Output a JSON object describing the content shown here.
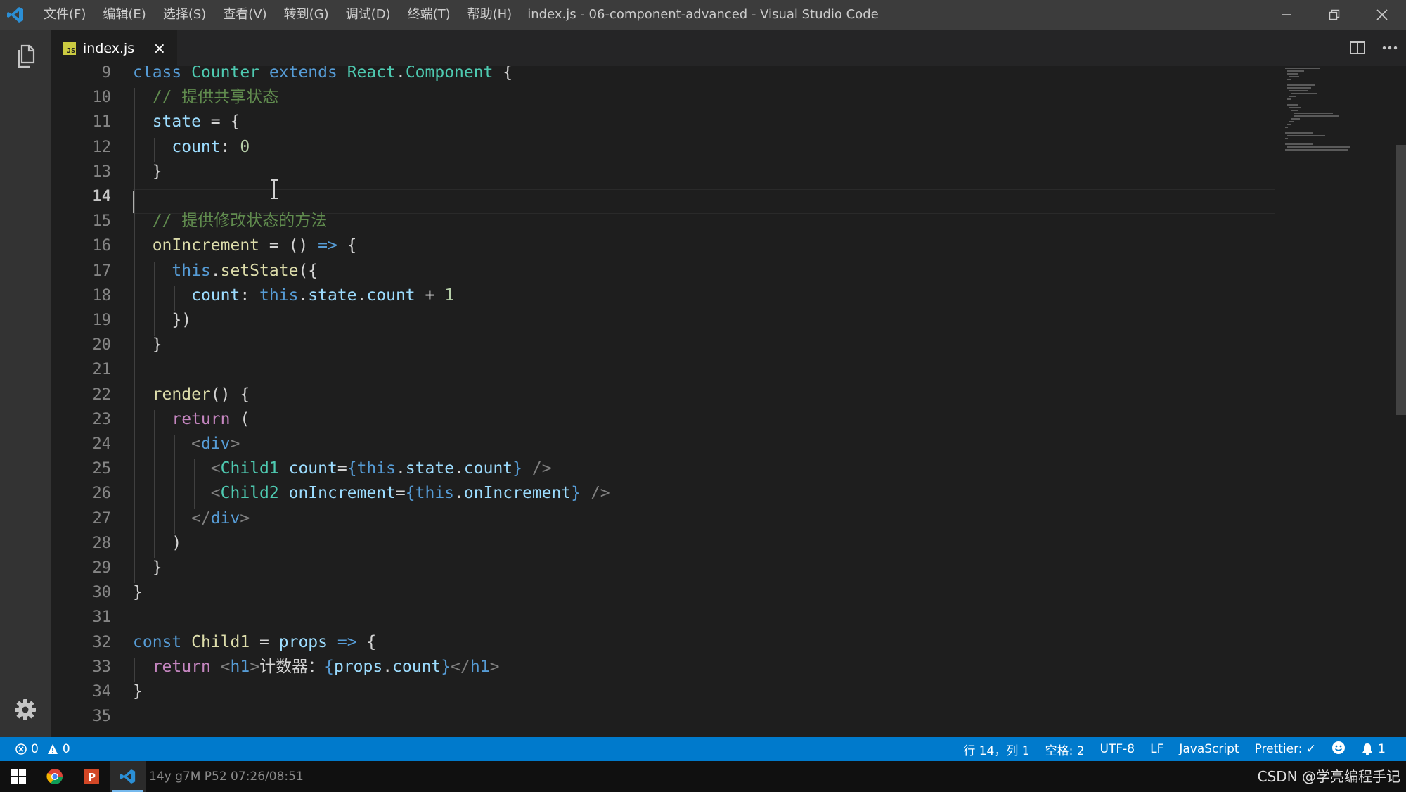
{
  "window": {
    "title": "index.js - 06-component-advanced - Visual Studio Code",
    "menu": [
      "文件(F)",
      "编辑(E)",
      "选择(S)",
      "查看(V)",
      "转到(G)",
      "调试(D)",
      "终端(T)",
      "帮助(H)"
    ]
  },
  "tab": {
    "label": "index.js",
    "close": "×"
  },
  "editor": {
    "current_line": 14,
    "line_numbers": [
      "9",
      "10",
      "11",
      "12",
      "13",
      "14",
      "15",
      "16",
      "17",
      "18",
      "19",
      "20",
      "21",
      "22",
      "23",
      "24",
      "25",
      "26",
      "27",
      "28",
      "29",
      "30",
      "31",
      "32",
      "33",
      "34",
      "35"
    ],
    "lines": [
      [
        [
          "kw",
          "class"
        ],
        [
          "plain",
          " "
        ],
        [
          "cls",
          "Counter"
        ],
        [
          "plain",
          " "
        ],
        [
          "kw",
          "extends"
        ],
        [
          "plain",
          " "
        ],
        [
          "cls",
          "React"
        ],
        [
          "plain",
          "."
        ],
        [
          "cls",
          "Component"
        ],
        [
          "plain",
          " {"
        ]
      ],
      [
        [
          "plain",
          "  "
        ],
        [
          "cm",
          "// "
        ],
        [
          "cm cjk",
          "提供共享状态"
        ]
      ],
      [
        [
          "plain",
          "  "
        ],
        [
          "var",
          "state"
        ],
        [
          "plain",
          " = {"
        ]
      ],
      [
        [
          "plain",
          "    "
        ],
        [
          "var",
          "count"
        ],
        [
          "plain",
          ": "
        ],
        [
          "num",
          "0"
        ]
      ],
      [
        [
          "plain",
          "  }"
        ]
      ],
      [],
      [
        [
          "plain",
          "  "
        ],
        [
          "cm",
          "// "
        ],
        [
          "cm cjk",
          "提供修改状态的方法"
        ]
      ],
      [
        [
          "plain",
          "  "
        ],
        [
          "fn",
          "onIncrement"
        ],
        [
          "plain",
          " = () "
        ],
        [
          "kw",
          "=>"
        ],
        [
          "plain",
          " {"
        ]
      ],
      [
        [
          "plain",
          "    "
        ],
        [
          "kw",
          "this"
        ],
        [
          "plain",
          "."
        ],
        [
          "fn",
          "setState"
        ],
        [
          "plain",
          "({"
        ]
      ],
      [
        [
          "plain",
          "      "
        ],
        [
          "var",
          "count"
        ],
        [
          "plain",
          ": "
        ],
        [
          "kw",
          "this"
        ],
        [
          "plain",
          "."
        ],
        [
          "var",
          "state"
        ],
        [
          "plain",
          "."
        ],
        [
          "var",
          "count"
        ],
        [
          "plain",
          " + "
        ],
        [
          "num",
          "1"
        ]
      ],
      [
        [
          "plain",
          "    })"
        ]
      ],
      [
        [
          "plain",
          "  }"
        ]
      ],
      [],
      [
        [
          "plain",
          "  "
        ],
        [
          "fn",
          "render"
        ],
        [
          "plain",
          "() {"
        ]
      ],
      [
        [
          "plain",
          "    "
        ],
        [
          "ctl",
          "return"
        ],
        [
          "plain",
          " ("
        ]
      ],
      [
        [
          "plain",
          "      "
        ],
        [
          "pun",
          "<"
        ],
        [
          "tag",
          "div"
        ],
        [
          "pun",
          ">"
        ]
      ],
      [
        [
          "plain",
          "        "
        ],
        [
          "pun",
          "<"
        ],
        [
          "cls",
          "Child1"
        ],
        [
          "plain",
          " "
        ],
        [
          "var",
          "count"
        ],
        [
          "plain",
          "="
        ],
        [
          "kw",
          "{"
        ],
        [
          "kw",
          "this"
        ],
        [
          "plain",
          "."
        ],
        [
          "var",
          "state"
        ],
        [
          "plain",
          "."
        ],
        [
          "var",
          "count"
        ],
        [
          "kw",
          "}"
        ],
        [
          "plain",
          " "
        ],
        [
          "pun",
          "/>"
        ]
      ],
      [
        [
          "plain",
          "        "
        ],
        [
          "pun",
          "<"
        ],
        [
          "cls",
          "Child2"
        ],
        [
          "plain",
          " "
        ],
        [
          "var",
          "onIncrement"
        ],
        [
          "plain",
          "="
        ],
        [
          "kw",
          "{"
        ],
        [
          "kw",
          "this"
        ],
        [
          "plain",
          "."
        ],
        [
          "var",
          "onIncrement"
        ],
        [
          "kw",
          "}"
        ],
        [
          "plain",
          " "
        ],
        [
          "pun",
          "/>"
        ]
      ],
      [
        [
          "plain",
          "      "
        ],
        [
          "pun",
          "</"
        ],
        [
          "tag",
          "div"
        ],
        [
          "pun",
          ">"
        ]
      ],
      [
        [
          "plain",
          "    )"
        ]
      ],
      [
        [
          "plain",
          "  }"
        ]
      ],
      [
        [
          "plain",
          "}"
        ]
      ],
      [],
      [
        [
          "kw",
          "const"
        ],
        [
          "plain",
          " "
        ],
        [
          "fn",
          "Child1"
        ],
        [
          "plain",
          " = "
        ],
        [
          "var",
          "props"
        ],
        [
          "plain",
          " "
        ],
        [
          "kw",
          "=>"
        ],
        [
          "plain",
          " {"
        ]
      ],
      [
        [
          "plain",
          "  "
        ],
        [
          "ctl",
          "return"
        ],
        [
          "plain",
          " "
        ],
        [
          "pun",
          "<"
        ],
        [
          "tag",
          "h1"
        ],
        [
          "pun",
          ">"
        ],
        [
          "plain cjk",
          "计数器："
        ],
        [
          "kw",
          "{"
        ],
        [
          "var",
          "props"
        ],
        [
          "plain",
          "."
        ],
        [
          "var",
          "count"
        ],
        [
          "kw",
          "}"
        ],
        [
          "pun",
          "</"
        ],
        [
          "tag",
          "h1"
        ],
        [
          "pun",
          ">"
        ]
      ],
      [
        [
          "plain",
          "}"
        ]
      ],
      []
    ]
  },
  "status": {
    "errors": "0",
    "warnings": "0",
    "position": "行 14，列 1",
    "spaces": "空格: 2",
    "encoding": "UTF-8",
    "eol": "LF",
    "language": "JavaScript",
    "formatter": "Prettier: ✓",
    "notifications": "1"
  },
  "taskbar": {
    "overlay_text": "14y   g7M  P52 07:26/08:51",
    "watermark": "CSDN @学亮编程手记"
  },
  "colors": {
    "statusbar": "#007acc",
    "titlebar": "#3c3c3c",
    "editor_bg": "#1e1e1e",
    "activitybar": "#333333"
  },
  "icons": {
    "app": "vscode-logo-icon",
    "explorer": "files-icon",
    "settings": "gear-icon",
    "split": "split-editor-icon",
    "more": "ellipsis-icon"
  }
}
